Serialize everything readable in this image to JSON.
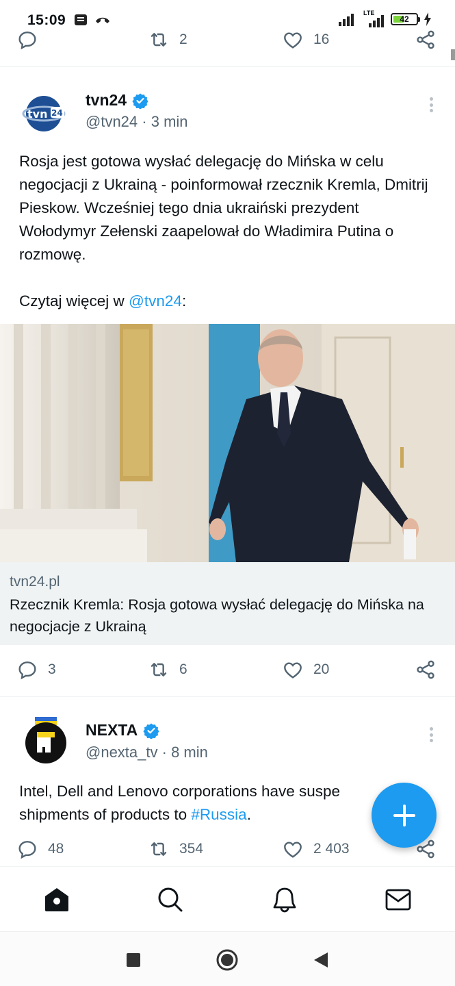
{
  "status_bar": {
    "time": "15:09",
    "network": "LTE",
    "battery": "42"
  },
  "top_actions": {
    "retweets": "2",
    "likes": "16"
  },
  "tweets": [
    {
      "name": "tvn24",
      "handle": "@tvn24",
      "sep": "·",
      "time": "3 min",
      "text": "Rosja jest gotowa wysłać delegację do Mińska w celu negocjacji z Ukrainą - poinformował rzecznik Kremla, Dmitrij Pieskow. Wcześniej tego dnia ukraiński prezydent Wołodymyr Zełenski zaapelował do Władimira Putina o rozmowę.",
      "text2_prefix": "Czytaj więcej w ",
      "text2_link": "@tvn24",
      "text2_suffix": ":",
      "avatar_label": "tvn24",
      "card": {
        "domain": "tvn24.pl",
        "title": "Rzecznik Kremla: Rosja gotowa wysłać delegację do Mińska na negocjacje z Ukrainą"
      },
      "replies": "3",
      "retweets": "6",
      "likes": "20"
    },
    {
      "name": "NEXTA",
      "handle": "@nexta_tv",
      "sep": "·",
      "time": "8 min",
      "text_prefix": "Intel, Dell and Lenovo corporations have suspe",
      "text_mid": "shipments of products to ",
      "text_link": "#Russia",
      "text_suffix": ".",
      "avatar_label": "N",
      "replies": "48",
      "retweets": "354",
      "likes": "2 403"
    }
  ],
  "colors": {
    "accent": "#1d9bf0",
    "secondary_text": "#536471"
  },
  "nav": [
    "home-icon",
    "search-icon",
    "notifications-icon",
    "messages-icon"
  ]
}
